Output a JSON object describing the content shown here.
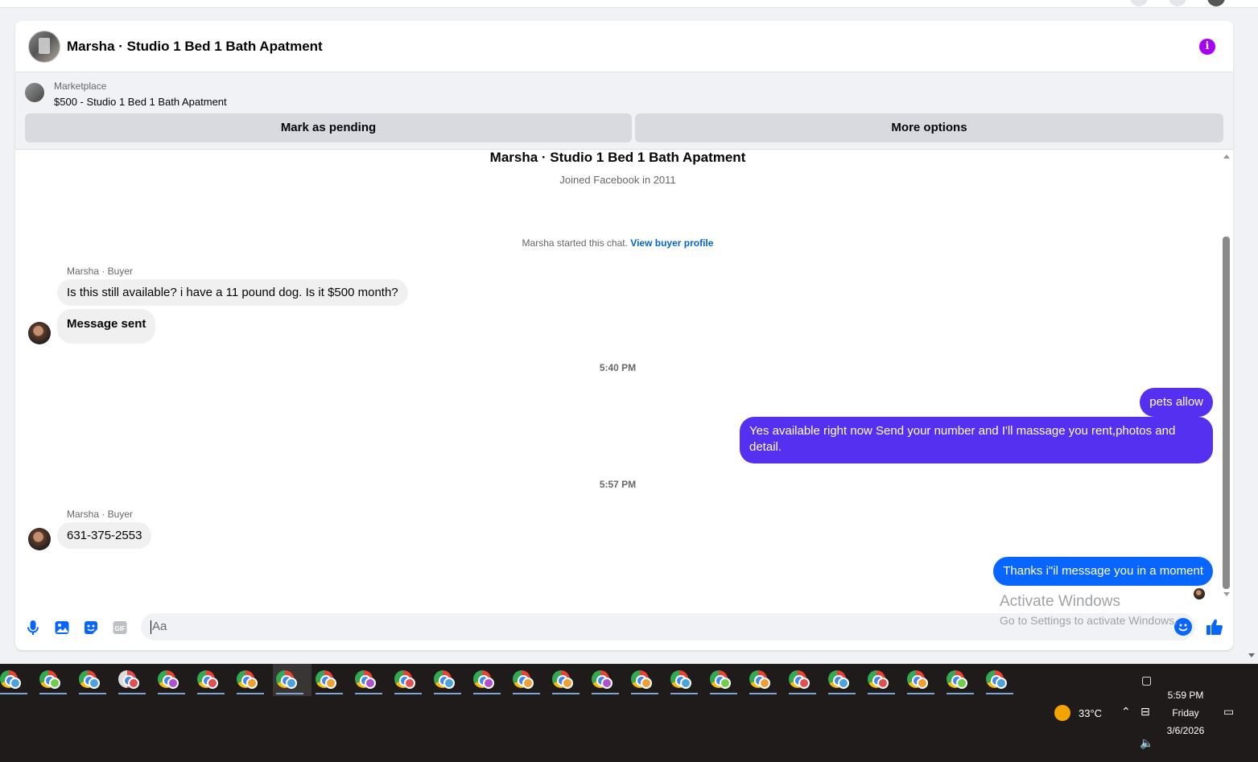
{
  "header": {
    "title": "Marsha · Studio 1 Bed 1 Bath Apatment",
    "info_icon": "info-icon"
  },
  "marketplace": {
    "label": "Marketplace",
    "listing": "$500 - Studio 1 Bed 1 Bath Apatment",
    "pending_label": "Mark as pending",
    "more_label": "More options"
  },
  "profile": {
    "name": "Marsha · Studio 1 Bed 1 Bath Apatment",
    "joined": "Joined Facebook in 2011"
  },
  "chat": {
    "started_text": "Marsha started this chat.",
    "view_profile": "View buyer profile",
    "messages": [
      {
        "sender": "Marsha · Buyer",
        "text": "Is this still available? i have a 11 pound dog. Is it $500 month?"
      },
      {
        "text": "Message sent"
      },
      {
        "timestamp": "5:40 PM"
      },
      {
        "text": "pets allow"
      },
      {
        "text": "Yes available right now Send your number and I'll massage you rent,photos and detail."
      },
      {
        "timestamp": "5:57 PM"
      },
      {
        "sender": "Marsha · Buyer",
        "text": "631-375-2553"
      },
      {
        "text": "Thanks i\"il message you in a moment"
      }
    ]
  },
  "composer": {
    "placeholder": "Aa",
    "icons": [
      "microphone-icon",
      "photo-icon",
      "sticker-icon",
      "gif-icon",
      "emoji-icon",
      "thumbs-up-icon"
    ]
  },
  "watermark": {
    "line1": "Activate Windows",
    "line2": "Go to Settings to activate Windows."
  },
  "taskbar": {
    "temperature": "33°C",
    "time": "5:59 PM",
    "day": "Friday",
    "date": "3/6/2026"
  },
  "colors": {
    "accent": "#0866ff",
    "outgoing_bubble": "#5530f0",
    "info_icon": "#a700f5"
  }
}
